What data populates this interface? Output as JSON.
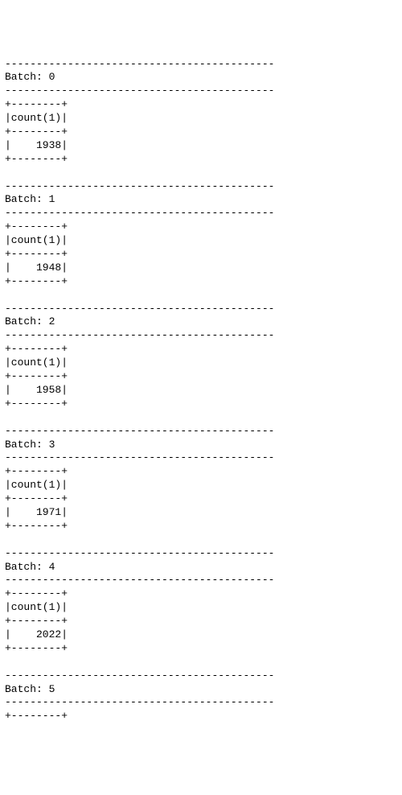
{
  "separator": "-------------------------------------------",
  "table_border": "+--------+",
  "column_header_line": "|count(1)|",
  "batch_label_prefix": "Batch: ",
  "batches": [
    {
      "index": 0,
      "value_line": "|    1938|"
    },
    {
      "index": 1,
      "value_line": "|    1948|"
    },
    {
      "index": 2,
      "value_line": "|    1958|"
    },
    {
      "index": 3,
      "value_line": "|    1971|"
    },
    {
      "index": 4,
      "value_line": "|    2022|"
    },
    {
      "index": 5,
      "value_line": null
    }
  ],
  "chart_data": {
    "type": "table",
    "title": "Streaming batch count(1) output",
    "columns": [
      "Batch",
      "count(1)"
    ],
    "rows": [
      [
        0,
        1938
      ],
      [
        1,
        1948
      ],
      [
        2,
        1958
      ],
      [
        3,
        1971
      ],
      [
        4,
        2022
      ]
    ]
  }
}
